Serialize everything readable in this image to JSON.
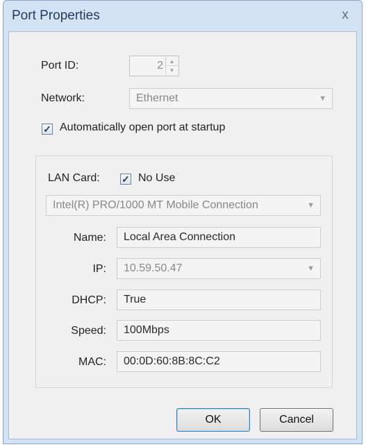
{
  "window": {
    "title": "Port Properties",
    "close_glyph": "x"
  },
  "port_id": {
    "label": "Port ID:",
    "value": "2"
  },
  "network": {
    "label": "Network:",
    "value": "Ethernet"
  },
  "auto_open": {
    "checked": true,
    "label": "Automatically open port at startup"
  },
  "lan": {
    "label": "LAN Card:",
    "no_use": {
      "checked": true,
      "label": "No Use"
    },
    "adapter": "Intel(R) PRO/1000 MT Mobile Connection",
    "name": {
      "label": "Name:",
      "value": "Local Area Connection"
    },
    "ip": {
      "label": "IP:",
      "value": "10.59.50.47"
    },
    "dhcp": {
      "label": "DHCP:",
      "value": "True"
    },
    "speed": {
      "label": "Speed:",
      "value": "100Mbps"
    },
    "mac": {
      "label": "MAC:",
      "value": "00:0D:60:8B:8C:C2"
    }
  },
  "buttons": {
    "ok": "OK",
    "cancel": "Cancel"
  },
  "icons": {
    "check": "checkmark-icon",
    "dropdown": "dropdown-arrow-icon",
    "spin": "spin-arrows-icon",
    "close": "close-icon"
  },
  "colors": {
    "title_bar": "#d4e3f3",
    "client": "#f0f0f0",
    "default_button_border": "#3c7fb1"
  }
}
